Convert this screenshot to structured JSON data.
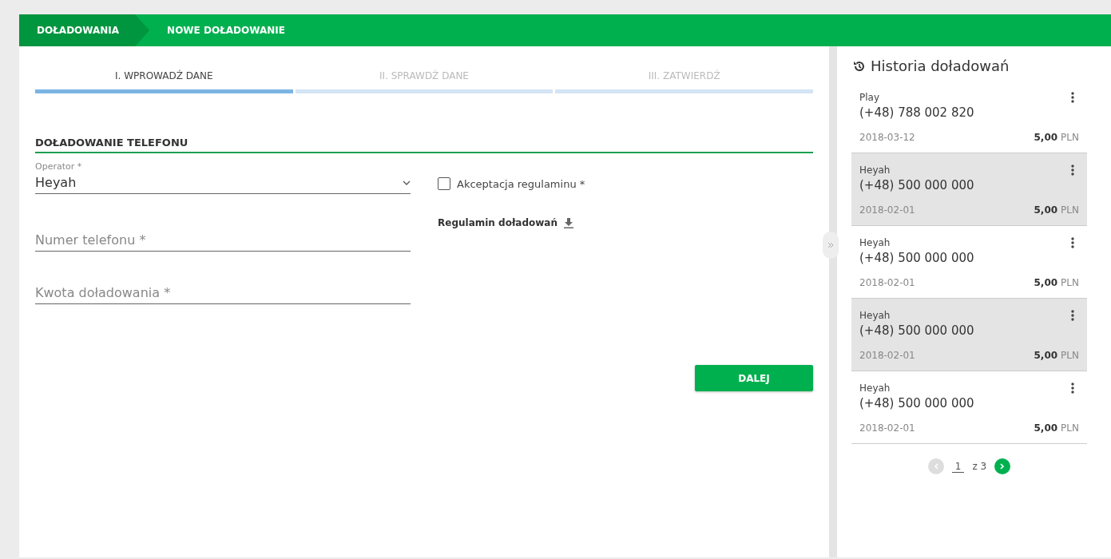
{
  "breadcrumb": [
    {
      "label": "DOŁADOWANIA",
      "selected": false
    },
    {
      "label": "NOWE DOŁADOWANIE",
      "selected": true
    }
  ],
  "steps": [
    {
      "label": "I. WPROWADŹ DANE",
      "selected": true
    },
    {
      "label": "II. SPRAWDŹ DANE",
      "selected": false
    },
    {
      "label": "III. ZATWIERDŹ",
      "selected": false
    }
  ],
  "section_title": "DOŁADOWANIE TELEFONU",
  "operator": {
    "label": "Operator *",
    "value": "Heyah"
  },
  "phone": {
    "placeholder": "Numer telefonu *"
  },
  "amount": {
    "placeholder": "Kwota doładowania *"
  },
  "terms": {
    "label": "Akceptacja regulaminu *",
    "checked": false
  },
  "terms_link": "Regulamin doładowań",
  "next_button": "DALEJ",
  "history": {
    "title": "Historia doładowań",
    "items": [
      {
        "operator": "Play",
        "number": "(+48) 788 002 820",
        "date": "2018-03-12",
        "amount": "5,00",
        "currency": "PLN",
        "highlighted": false
      },
      {
        "operator": "Heyah",
        "number": "(+48) 500 000 000",
        "date": "2018-02-01",
        "amount": "5,00",
        "currency": "PLN",
        "highlighted": true
      },
      {
        "operator": "Heyah",
        "number": "(+48) 500 000 000",
        "date": "2018-02-01",
        "amount": "5,00",
        "currency": "PLN",
        "highlighted": false
      },
      {
        "operator": "Heyah",
        "number": "(+48) 500 000 000",
        "date": "2018-02-01",
        "amount": "5,00",
        "currency": "PLN",
        "highlighted": true
      },
      {
        "operator": "Heyah",
        "number": "(+48) 500 000 000",
        "date": "2018-02-01",
        "amount": "5,00",
        "currency": "PLN",
        "highlighted": false
      }
    ],
    "pagination": {
      "page": "1",
      "of": "z 3",
      "prev_disabled": true,
      "next_disabled": false
    }
  }
}
